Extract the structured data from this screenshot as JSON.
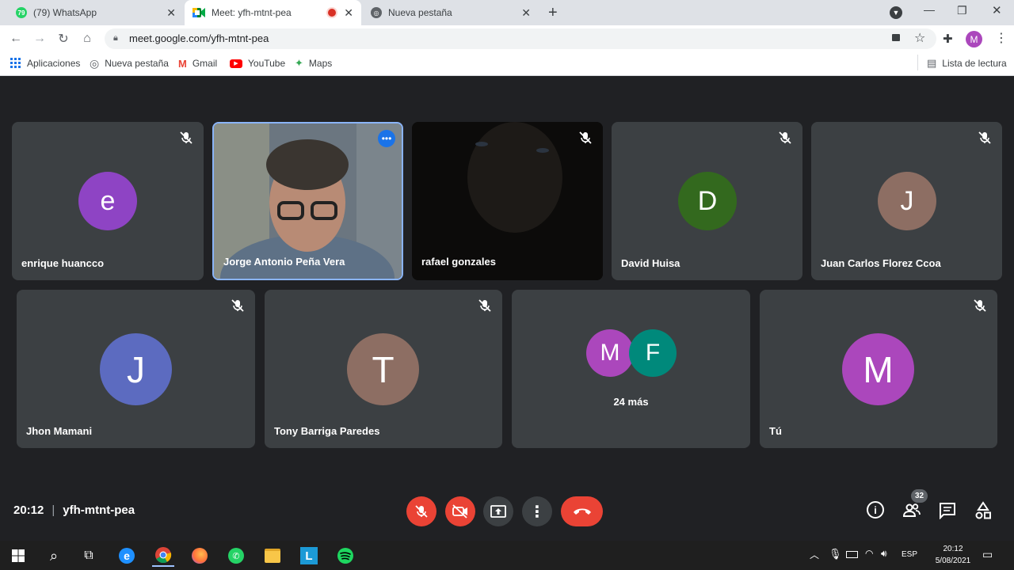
{
  "tabs": [
    {
      "title": "(79) WhatsApp",
      "badge": "79"
    },
    {
      "title": "Meet: yfh-mtnt-pea"
    },
    {
      "title": "Nueva pestaña"
    }
  ],
  "address": {
    "url": "meet.google.com/yfh-mtnt-pea"
  },
  "profile_initial": "M",
  "bookmarks": [
    {
      "label": "Aplicaciones"
    },
    {
      "label": "Nueva pestaña"
    },
    {
      "label": "Gmail"
    },
    {
      "label": "YouTube"
    },
    {
      "label": "Maps"
    }
  ],
  "reading_list": "Lista de lectura",
  "participants": [
    {
      "name": "enrique huancco",
      "initial": "e",
      "color": "#8e44c4"
    },
    {
      "name": "Jorge Antonio Peña Vera"
    },
    {
      "name": "rafael gonzales"
    },
    {
      "name": "David Huisa",
      "initial": "D",
      "color": "#33691e"
    },
    {
      "name": "Juan Carlos Florez Ccoa",
      "initial": "J",
      "color": "#8d6e63"
    },
    {
      "name": "Jhon Mamani",
      "initial": "J",
      "color": "#5c6bc0"
    },
    {
      "name": "Tony Barriga Paredes",
      "initial": "T",
      "color": "#8d6e63"
    },
    {
      "name": "Tú",
      "initial": "M",
      "color": "#ab47bc"
    }
  ],
  "overflow": {
    "initials": [
      "M",
      "F"
    ],
    "colors": [
      "#ab47bc",
      "#00897b"
    ],
    "label": "24 más"
  },
  "meeting": {
    "time": "20:12",
    "separator": "|",
    "code": "yfh-mtnt-pea"
  },
  "people_count": "32",
  "taskbar": {
    "lang": "ESP",
    "time": "20:12",
    "date": "5/08/2021"
  }
}
